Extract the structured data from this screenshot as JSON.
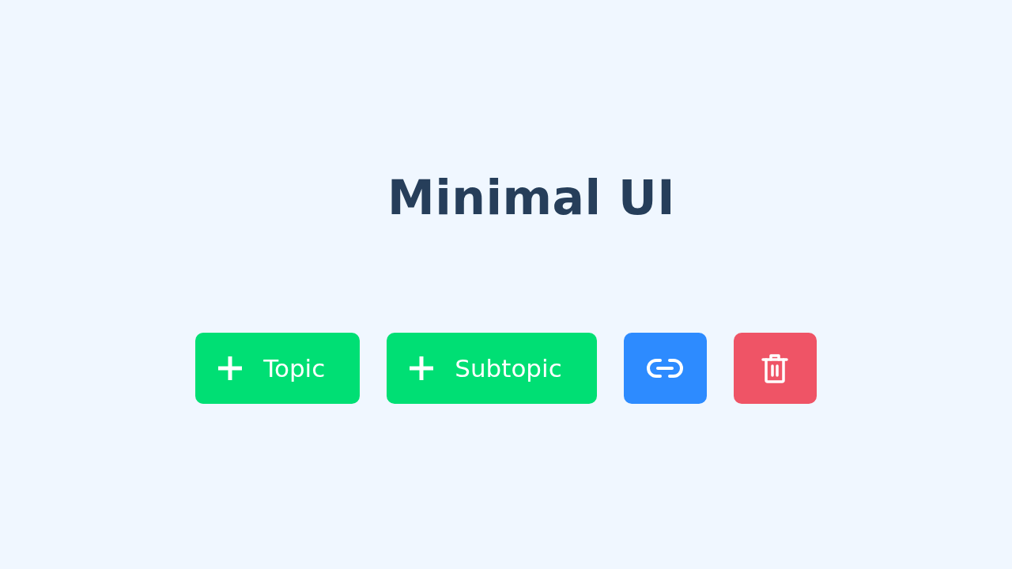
{
  "title": "Minimal UI",
  "buttons": [
    {
      "kind": "add",
      "label": "Topic"
    },
    {
      "kind": "add",
      "label": "Subtopic"
    },
    {
      "kind": "link"
    },
    {
      "kind": "delete"
    }
  ]
}
